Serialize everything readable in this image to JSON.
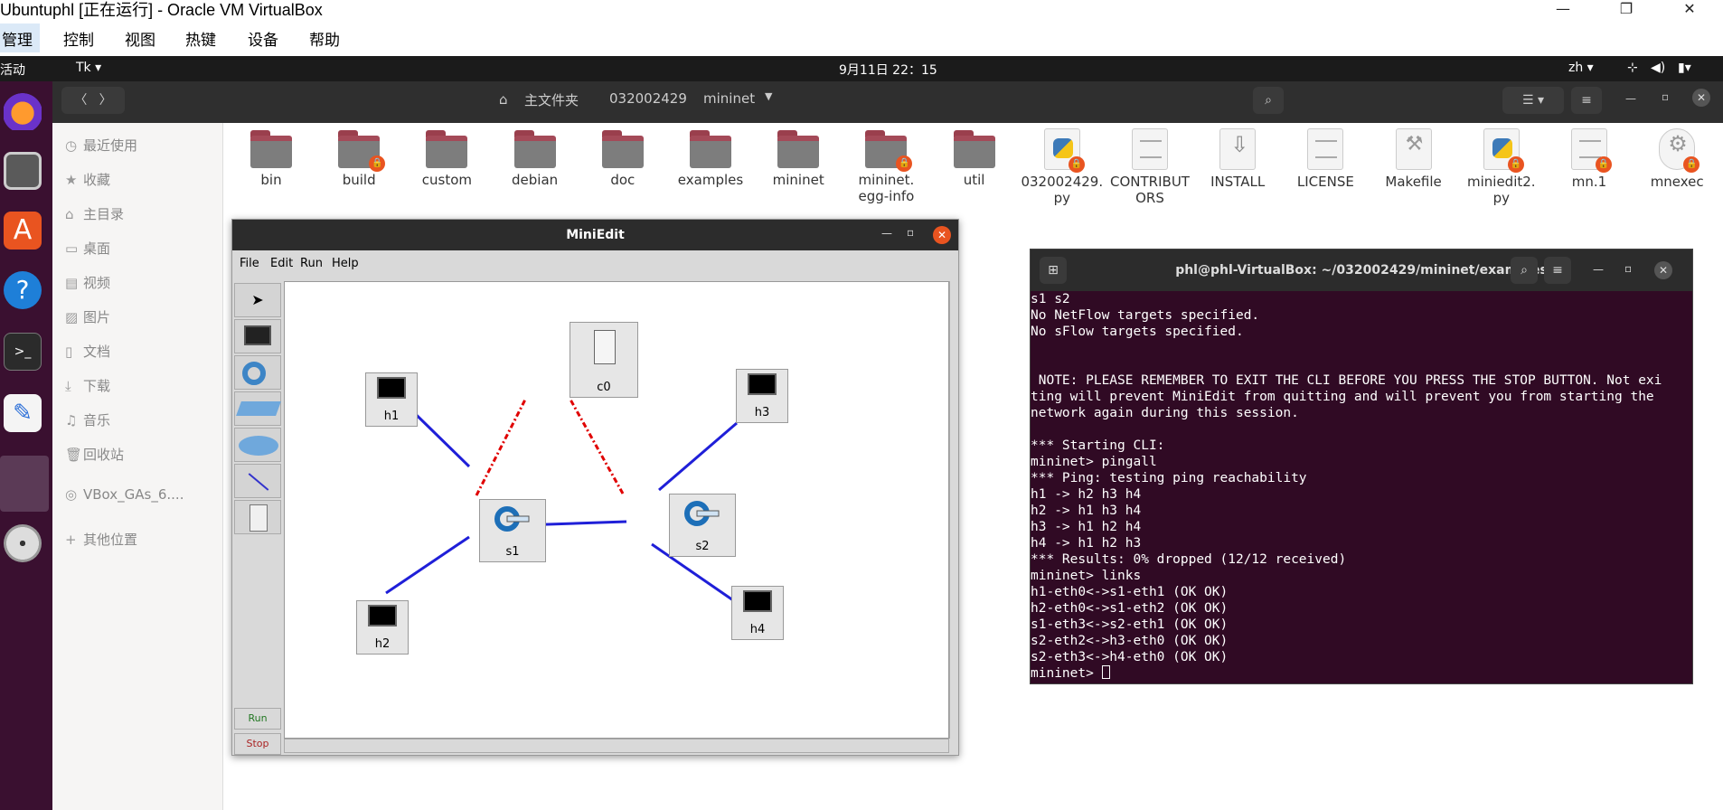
{
  "vbox": {
    "title": "Ubuntuphl [正在运行] - Oracle VM VirtualBox",
    "menu": [
      "管理",
      "控制",
      "视图",
      "热键",
      "设备",
      "帮助"
    ],
    "minimize": "—",
    "restore": "❐",
    "close": "✕"
  },
  "topbar": {
    "activities": "活动",
    "app": "Tk ▾",
    "clock": "9月11日  22：15",
    "lang": "zh ▾"
  },
  "files": {
    "path": [
      "主文件夹",
      "032002429",
      "mininet"
    ],
    "sidebar": [
      {
        "icon": "clock-icon",
        "glyph": "◷",
        "label": "最近使用"
      },
      {
        "icon": "star-icon",
        "glyph": "★",
        "label": "收藏"
      },
      {
        "icon": "home-icon",
        "glyph": "⌂",
        "label": "主目录"
      },
      {
        "icon": "desktop-icon",
        "glyph": "▭",
        "label": "桌面"
      },
      {
        "icon": "video-icon",
        "glyph": "▤",
        "label": "视频"
      },
      {
        "icon": "picture-icon",
        "glyph": "▨",
        "label": "图片"
      },
      {
        "icon": "document-icon",
        "glyph": "▯",
        "label": "文档"
      },
      {
        "icon": "download-icon",
        "glyph": "⤓",
        "label": "下载"
      },
      {
        "icon": "music-icon",
        "glyph": "♫",
        "label": "音乐"
      },
      {
        "icon": "trash-icon",
        "glyph": "🗑",
        "label": "回收站"
      },
      {
        "icon": "disc-icon",
        "glyph": "◎",
        "label": "VBox_GAs_6...."
      },
      {
        "icon": "plus-icon",
        "glyph": "+",
        "label": "其他位置"
      }
    ],
    "items": [
      {
        "name": "bin",
        "kind": "folder",
        "locked": false
      },
      {
        "name": "build",
        "kind": "folder",
        "locked": true
      },
      {
        "name": "custom",
        "kind": "folder",
        "locked": false
      },
      {
        "name": "debian",
        "kind": "folder",
        "locked": false
      },
      {
        "name": "doc",
        "kind": "folder",
        "locked": false
      },
      {
        "name": "examples",
        "kind": "folder",
        "locked": false
      },
      {
        "name": "mininet",
        "kind": "folder",
        "locked": false
      },
      {
        "name": "mininet.\negg-info",
        "kind": "folder",
        "locked": true
      },
      {
        "name": "util",
        "kind": "folder",
        "locked": false
      },
      {
        "name": "032002429.\npy",
        "kind": "python",
        "locked": true
      },
      {
        "name": "CONTRIBUT\nORS",
        "kind": "text",
        "locked": false
      },
      {
        "name": "INSTALL",
        "kind": "install",
        "locked": false
      },
      {
        "name": "LICENSE",
        "kind": "text",
        "locked": false
      },
      {
        "name": "Makefile",
        "kind": "make",
        "locked": false
      },
      {
        "name": "miniedit2.\npy",
        "kind": "python",
        "locked": true
      },
      {
        "name": "mn.1",
        "kind": "text",
        "locked": true
      },
      {
        "name": "mnexec",
        "kind": "exec",
        "locked": true
      }
    ]
  },
  "miniedit": {
    "title": "MiniEdit",
    "menu": [
      "File",
      "Edit",
      "Run",
      "Help"
    ],
    "run": "Run",
    "stop": "Stop",
    "nodes": [
      {
        "id": "h1",
        "type": "host"
      },
      {
        "id": "h2",
        "type": "host"
      },
      {
        "id": "h3",
        "type": "host"
      },
      {
        "id": "h4",
        "type": "host"
      },
      {
        "id": "s1",
        "type": "switch"
      },
      {
        "id": "s2",
        "type": "switch"
      },
      {
        "id": "c0",
        "type": "controller"
      }
    ]
  },
  "terminal": {
    "title": "phl@phl-VirtualBox: ~/032002429/mininet/examples",
    "lines": [
      "s1 s2",
      "No NetFlow targets specified.",
      "No sFlow targets specified.",
      "",
      "",
      " NOTE: PLEASE REMEMBER TO EXIT THE CLI BEFORE YOU PRESS THE STOP BUTTON. Not exi",
      "ting will prevent MiniEdit from quitting and will prevent you from starting the",
      "network again during this session.",
      "",
      "*** Starting CLI:",
      "mininet> pingall",
      "*** Ping: testing ping reachability",
      "h1 -> h2 h3 h4",
      "h2 -> h1 h3 h4",
      "h3 -> h1 h2 h4",
      "h4 -> h1 h2 h3",
      "*** Results: 0% dropped (12/12 received)",
      "mininet> links",
      "h1-eth0<->s1-eth1 (OK OK)",
      "h2-eth0<->s1-eth2 (OK OK)",
      "s1-eth3<->s2-eth1 (OK OK)",
      "s2-eth2<->h3-eth0 (OK OK)",
      "s2-eth3<->h4-eth0 (OK OK)"
    ],
    "prompt": "mininet> "
  }
}
